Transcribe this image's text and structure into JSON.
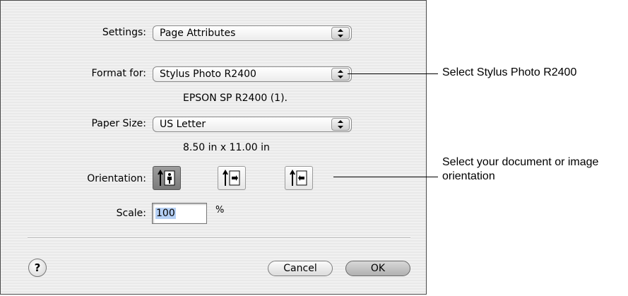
{
  "dialog": {
    "settings": {
      "label": "Settings:",
      "value": "Page Attributes"
    },
    "format_for": {
      "label": "Format for:",
      "value": "Stylus Photo R2400",
      "detail": "EPSON SP R2400 (1)."
    },
    "paper_size": {
      "label": "Paper Size:",
      "value": "US Letter",
      "detail": "8.50 in x 11.00 in"
    },
    "orientation": {
      "label": "Orientation:",
      "options": [
        {
          "icon": "portrait-orientation-icon",
          "selected": true
        },
        {
          "icon": "landscape-orientation-icon",
          "selected": false
        },
        {
          "icon": "reverse-landscape-orientation-icon",
          "selected": false
        }
      ]
    },
    "scale": {
      "label": "Scale:",
      "value": "100",
      "unit": "%"
    },
    "help_label": "?",
    "cancel_label": "Cancel",
    "ok_label": "OK"
  },
  "callouts": {
    "format": "Select Stylus Photo R2400",
    "orientation": "Select your document or image orientation"
  }
}
